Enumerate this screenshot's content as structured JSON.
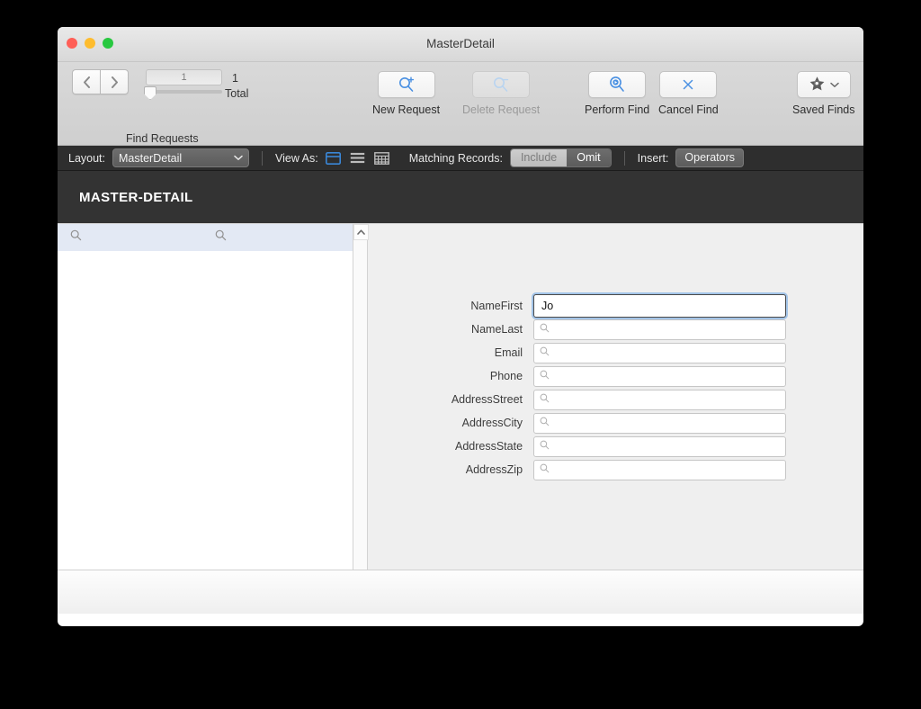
{
  "window": {
    "title": "MasterDetail",
    "traffic_lights": [
      {
        "name": "close",
        "color": "#ff5f57"
      },
      {
        "name": "minimize",
        "color": "#febc2e"
      },
      {
        "name": "zoom",
        "color": "#28c840"
      }
    ]
  },
  "toolbar": {
    "nav": {
      "prev_icon": "chevron-left-icon",
      "next_icon": "chevron-right-icon",
      "request_number": "1",
      "total_number": "1",
      "total_label": "Total",
      "group_label": "Find Requests"
    },
    "items": [
      {
        "name": "new-request",
        "label": "New Request",
        "icon": "magnifier-plus-icon",
        "disabled": false
      },
      {
        "name": "delete-request",
        "label": "Delete Request",
        "icon": "magnifier-minus-icon",
        "disabled": true
      },
      {
        "name": "perform-find",
        "label": "Perform Find",
        "icon": "magnifier-play-icon",
        "disabled": false
      },
      {
        "name": "cancel-find",
        "label": "Cancel Find",
        "icon": "close-x-icon",
        "disabled": false
      }
    ],
    "saved_finds": {
      "label": "Saved Finds",
      "icon": "star-magnifier-icon",
      "chevron": "chevron-down-icon"
    }
  },
  "layoutbar": {
    "layout_label": "Layout:",
    "layout_value": "MasterDetail",
    "layout_chevron": "chevron-down-icon",
    "view_as_label": "View As:",
    "view_modes": [
      {
        "name": "form-view",
        "icon": "form-view-icon",
        "selected": true
      },
      {
        "name": "list-view",
        "icon": "list-view-icon",
        "selected": false
      },
      {
        "name": "table-view",
        "icon": "table-view-icon",
        "selected": false
      }
    ],
    "matching_records_label": "Matching Records:",
    "matching_include": "Include",
    "matching_omit": "Omit",
    "matching_selected": "Omit",
    "insert_label": "Insert:",
    "insert_value": "Operators"
  },
  "header": {
    "title": "MASTER-DETAIL"
  },
  "list_pane": {
    "rows": [
      {
        "selected": true,
        "cells": [
          {
            "name": "list-cell-first",
            "icon": "search-icon",
            "value": ""
          },
          {
            "name": "list-cell-second",
            "icon": "search-icon",
            "value": ""
          }
        ]
      }
    ],
    "scrollbar": {
      "up_icon": "chevron-up-icon",
      "down_icon": "chevron-down-icon"
    }
  },
  "form": {
    "fields": [
      {
        "name": "namefirst",
        "label": "NameFirst",
        "value": "Jo",
        "focused": true,
        "icon": "search-icon"
      },
      {
        "name": "namelast",
        "label": "NameLast",
        "value": "",
        "focused": false,
        "icon": "search-icon"
      },
      {
        "name": "email",
        "label": "Email",
        "value": "",
        "focused": false,
        "icon": "search-icon"
      },
      {
        "name": "phone",
        "label": "Phone",
        "value": "",
        "focused": false,
        "icon": "search-icon"
      },
      {
        "name": "addressstreet",
        "label": "AddressStreet",
        "value": "",
        "focused": false,
        "icon": "search-icon"
      },
      {
        "name": "addresscity",
        "label": "AddressCity",
        "value": "",
        "focused": false,
        "icon": "search-icon"
      },
      {
        "name": "addressstate",
        "label": "AddressState",
        "value": "",
        "focused": false,
        "icon": "search-icon"
      },
      {
        "name": "addresszip",
        "label": "AddressZip",
        "value": "",
        "focused": false,
        "icon": "search-icon"
      }
    ]
  },
  "colors": {
    "accent_blue": "#3a86d6",
    "header_dark": "#333333",
    "layoutbar_dark": "#2e2e2e",
    "selected_row": "#e3e9f4",
    "body_gray": "#efefef"
  }
}
